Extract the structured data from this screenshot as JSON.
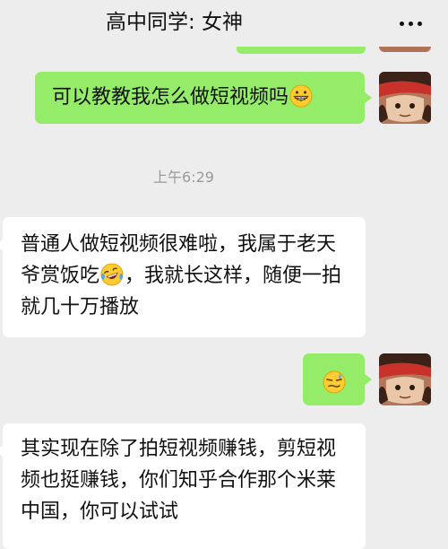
{
  "header": {
    "title": "高中同学: 女神",
    "more_icon": "more-dots-icon"
  },
  "messages": [
    {
      "side": "right",
      "text": "可以教教我怎么做短视频吗",
      "emoji": "grinning-face-emoji"
    },
    {
      "type": "timestamp",
      "text": "上午6:29"
    },
    {
      "side": "left",
      "text_part1": "普通人做短视频很难啦，我属于老天爷赏饭吃",
      "emoji": "laughing-tears-emoji",
      "text_part2": "，我就长这样，随便一拍就几十万播放"
    },
    {
      "side": "right",
      "emoji": "awkward-sweat-emoji"
    },
    {
      "side": "left",
      "text": "其实现在除了拍短视频赚钱，剪短视频也挺赚钱，你们知乎合作那个米莱中国，你可以试试"
    }
  ],
  "colors": {
    "background": "#ededed",
    "outgoing_bubble": "#95ec69",
    "incoming_bubble": "#ffffff",
    "timestamp_text": "#9a9a9a"
  }
}
